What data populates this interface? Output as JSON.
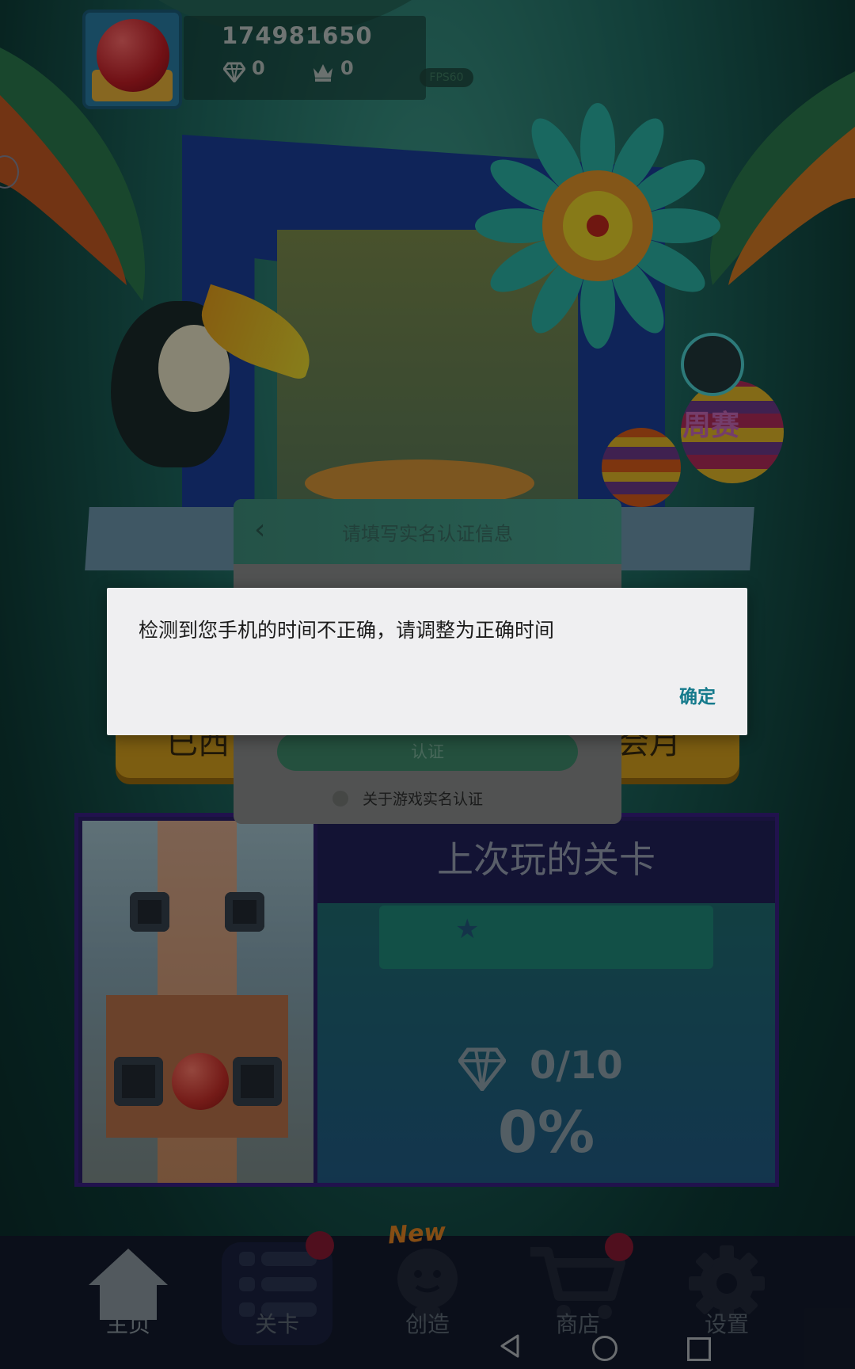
{
  "header": {
    "player_id": "174981650",
    "diamonds": "0",
    "crowns": "0",
    "fps": "FPS60"
  },
  "scene": {
    "weekly_label": "周赛"
  },
  "banner": {
    "left_text": "已西",
    "right_text": "会月"
  },
  "auth_dialog": {
    "title": "请填写实名认证信息",
    "submit_label": "认证",
    "about_label": "关于游戏实名认证"
  },
  "alert": {
    "message": "检测到您手机的时间不正确，请调整为正确时间",
    "ok_label": "确定"
  },
  "last_level": {
    "title": "上次玩的关卡",
    "gems": "0/10",
    "progress_percent": "0%",
    "progress_value": 0
  },
  "bottom_nav": {
    "items": [
      {
        "label": "主页",
        "icon": "home-icon"
      },
      {
        "label": "关卡",
        "icon": "list-icon"
      },
      {
        "label": "创造",
        "icon": "lightbulb-icon",
        "tag": "New"
      },
      {
        "label": "商店",
        "icon": "cart-icon"
      },
      {
        "label": "设置",
        "icon": "gear-icon"
      }
    ]
  },
  "colors": {
    "accent_link": "#157a8c",
    "badge": "#8b1a35",
    "new_tag": "#e58624"
  }
}
